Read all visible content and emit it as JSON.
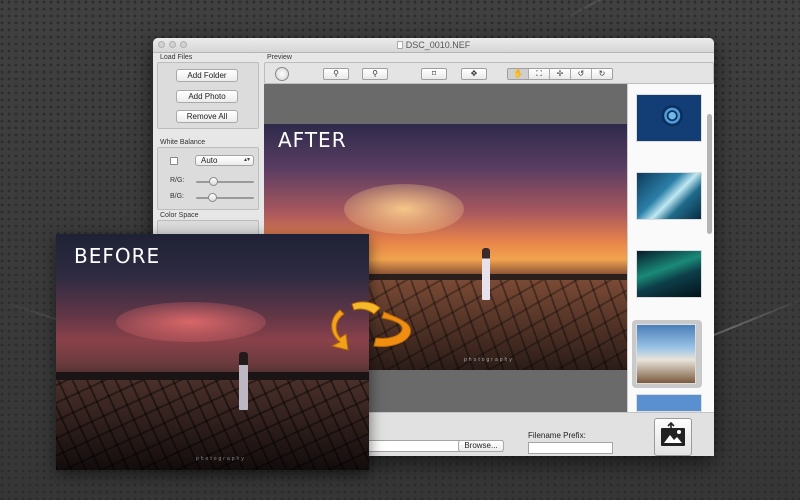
{
  "window": {
    "title": "DSC_0010.NEF"
  },
  "load_files": {
    "label": "Load Files",
    "add_folder": "Add Folder",
    "add_photo": "Add Photo",
    "remove_all": "Remove All"
  },
  "white_balance": {
    "label": "White Balance",
    "mode_value": "Auto",
    "rg_label": "R/G:",
    "bg_label": "B/G:",
    "rg_level": 0.3,
    "bg_level": 0.28
  },
  "color_space": {
    "label": "Color Space"
  },
  "preview": {
    "label": "Preview"
  },
  "overlay": {
    "after_label": "AFTER",
    "before_label": "BEFORE",
    "watermark": "photography"
  },
  "bottom": {
    "browse_label": "Browse...",
    "filename_prefix_label": "Filename Prefix:"
  },
  "icons": {
    "rotate_dial": "dial-icon",
    "tools": [
      "hand-icon",
      "crop-frame-icon",
      "straighten-icon",
      "rotate-left-icon",
      "rotate-right-icon"
    ]
  }
}
